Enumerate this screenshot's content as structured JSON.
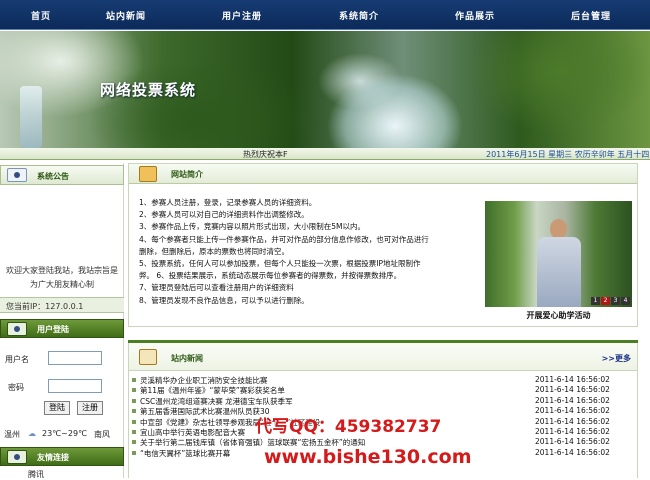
{
  "nav": [
    "首页",
    "站内新闻",
    "用户注册",
    "系统简介",
    "作品展示",
    "后台管理"
  ],
  "banner": {
    "title": "网络投票系统"
  },
  "infobar": {
    "marquee": "热烈庆祝本F",
    "date": "2011年6月15日  星期三  农历辛卯年  五月十四"
  },
  "sidebar": {
    "notice_title": "系统公告",
    "notice_text": "欢迎大家登陆我站，我站宗旨是为广大朋友精心制",
    "ip": "您当前IP：127.0.0.1",
    "login_title": "用户登陆",
    "username_label": "用户名",
    "password_label": "密码",
    "login_button": "登陆",
    "register_button": "注册",
    "weather": {
      "city": "温州",
      "temp": "23℃~29℃",
      "wind": "南风"
    },
    "links_title": "友情连接",
    "links_first": "腾讯"
  },
  "intro": {
    "title": "网站简介",
    "items": [
      "1、参赛人员注册，登录，记录参赛人员的详细资料。",
      "2、参赛人员可以对自己的详细资料作出调整修改。",
      "3、参赛作品上传，竞赛内容以照片形式出现，大小限制在5M以内。",
      "4、每个参赛者只能上传一件参赛作品，并可对作品的部分信息作修改，也可对作品进行",
      "删除，但删除后，原本的票数也将同时清空。",
      "5、投票系统，任何人可以参加投票，但每个人只能投一次票，根据投票IP地址限制作",
      "弊。  6、投票结果展示，系统动态展示每位参赛者的得票数，并按得票数排序。",
      "7、管理员登陆后可以查看注册用户的详细资料",
      "8、管理员发现不良作品信息，可以予以进行删除。"
    ],
    "photo_caption": "开展爱心助学活动",
    "photo_pages": [
      "1",
      "2",
      "3",
      "4"
    ]
  },
  "news": {
    "title": "站内新闻",
    "more": ">>更多",
    "items": [
      {
        "title": "灵溪精华办企业职工消防安全技能比赛",
        "date": "2011-6-14  16:56:02"
      },
      {
        "title": "第11届《温州年鉴》“蒙毕荣”赛彩获奖名单",
        "date": "2011-6-14  16:56:02"
      },
      {
        "title": "CSC温州龙湾组道赛决赛 龙港德宝车队获季军",
        "date": "2011-6-14  16:56:02"
      },
      {
        "title": "第五届香港国际武术比赛温州队员获30",
        "date": "2011-6-14  16:56:02"
      },
      {
        "title": "中宣部《党建》杂志社领导参观我局“五个一”社区建设",
        "date": "2011-6-14  16:56:02"
      },
      {
        "title": "宜山高中举行英语电影配音大赛",
        "date": "2011-6-14  16:56:02"
      },
      {
        "title": "关于举行第二届钱库镇（省体育强镇）篮球联赛“宏扬五金杯”的通知",
        "date": "2011-6-14  16:56:02"
      },
      {
        "title": "“电信天翼杯”篮球比赛开幕",
        "date": "2011-6-14  16:56:02"
      }
    ]
  },
  "watermark": {
    "qq": "代写QQ：459382737",
    "site": "www.bishe130.com"
  }
}
